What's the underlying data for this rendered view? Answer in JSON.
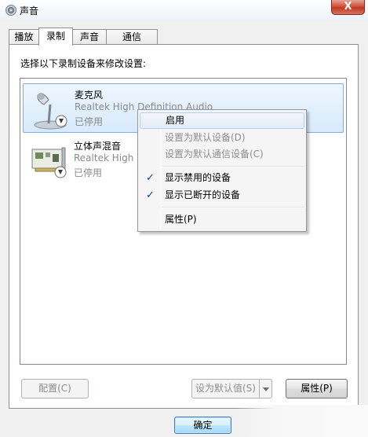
{
  "window": {
    "title": "声音",
    "close_label": "X"
  },
  "tabs": [
    {
      "label": "播放"
    },
    {
      "label": "录制"
    },
    {
      "label": "声音"
    },
    {
      "label": "通信"
    }
  ],
  "panel": {
    "instruction": "选择以下录制设备来修改设置:"
  },
  "devices": [
    {
      "name": "麦克风",
      "description": "Realtek High Definition Audio",
      "status": "已停用",
      "icon": "microphone-icon"
    },
    {
      "name": "立体声混音",
      "description": "Realtek High D",
      "status": "已停用",
      "icon": "sound-card-icon"
    }
  ],
  "context_menu": {
    "items": [
      {
        "label": "启用"
      },
      {
        "label": "设置为默认设备(D)"
      },
      {
        "label": "设置为默认通信设备(C)"
      },
      {
        "label": "显示禁用的设备"
      },
      {
        "label": "显示已断开的设备"
      },
      {
        "label": "属性(P)"
      }
    ],
    "check_glyph": "✓"
  },
  "buttons": {
    "configure": "配置(C)",
    "set_default": "设为默认值(S)",
    "properties": "属性(P)",
    "ok": "确定"
  }
}
